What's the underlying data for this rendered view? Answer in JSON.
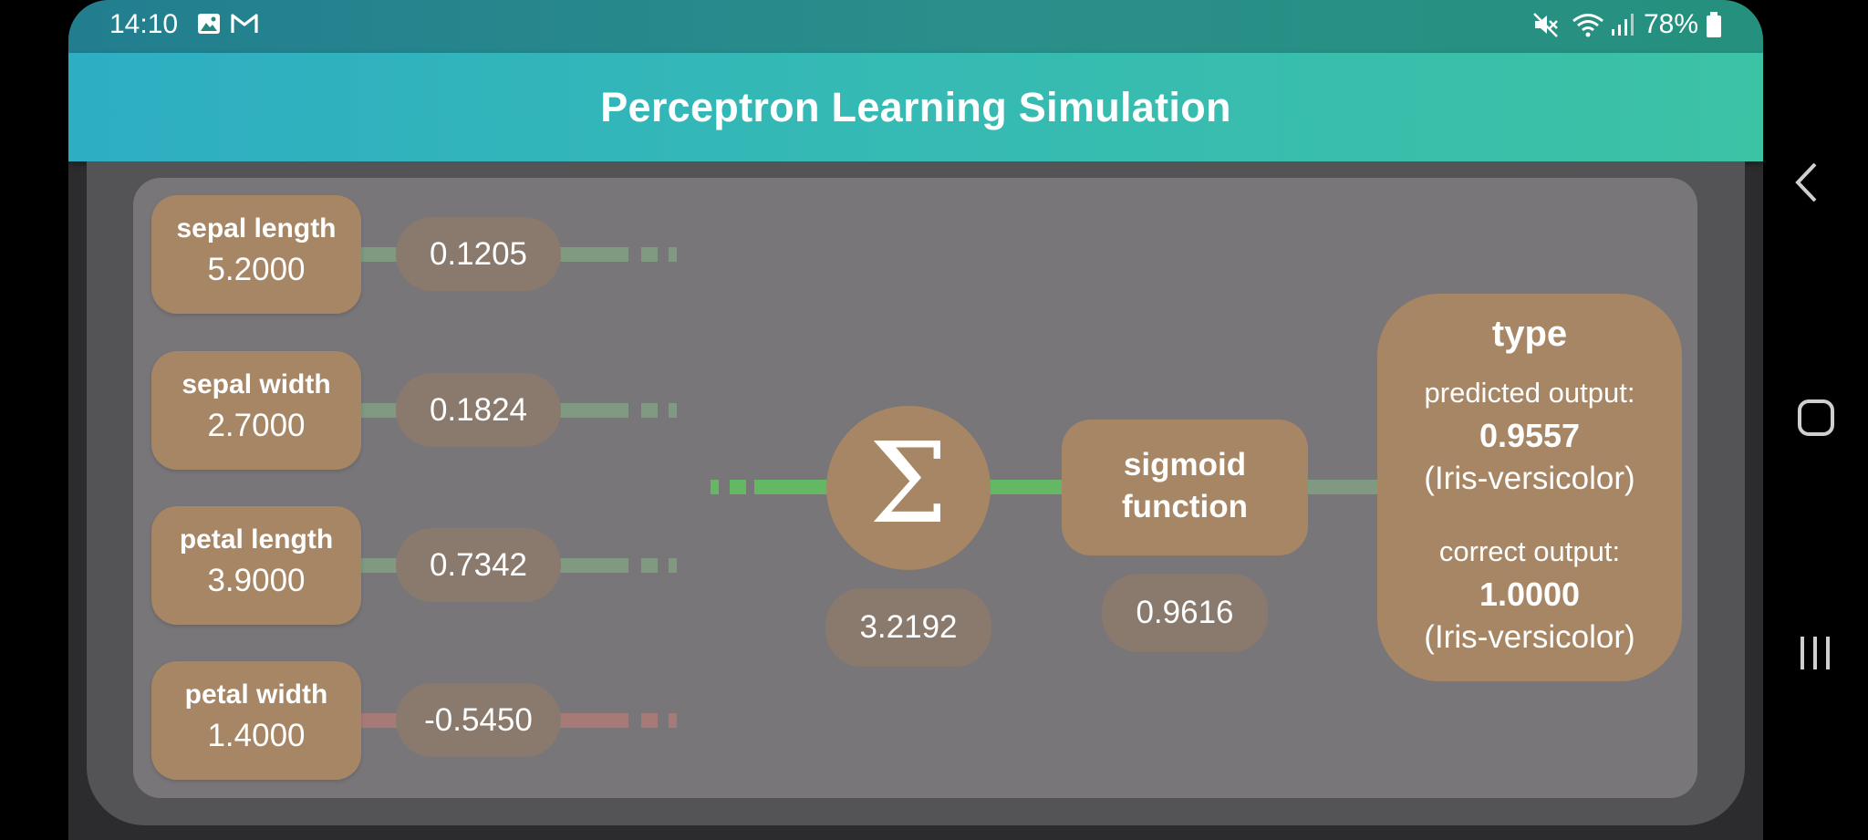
{
  "status_bar": {
    "time": "14:10",
    "battery": "78%",
    "icons": [
      "gallery-icon",
      "gmail-icon",
      "mute-icon",
      "wifi-icon",
      "signal-icon",
      "battery-icon"
    ]
  },
  "app_bar": {
    "title": "Perceptron Learning Simulation"
  },
  "inputs": [
    {
      "label": "sepal length",
      "value": "5.2000",
      "weight": "0.1205",
      "sign": "positive"
    },
    {
      "label": "sepal width",
      "value": "2.7000",
      "weight": "0.1824",
      "sign": "positive"
    },
    {
      "label": "petal length",
      "value": "3.9000",
      "weight": "0.7342",
      "sign": "positive"
    },
    {
      "label": "petal width",
      "value": "1.4000",
      "weight": "-0.5450",
      "sign": "negative"
    }
  ],
  "summation": {
    "symbol": "Σ",
    "value": "3.2192"
  },
  "activation": {
    "line1": "sigmoid",
    "line2": "function",
    "value": "0.9616"
  },
  "output": {
    "title": "type",
    "predicted_label": "predicted output:",
    "predicted_value": "0.9557",
    "predicted_class": "(Iris-versicolor)",
    "correct_label": "correct output:",
    "correct_value": "1.0000",
    "correct_class": "(Iris-versicolor)"
  },
  "colors": {
    "status_bar": "#26877f",
    "app_bar": "#35b9b5",
    "node": "#a68664",
    "value_pill": "#8a7a6e",
    "positive_line": "#7f9a80",
    "negative_line": "#a87a77",
    "active_line": "#64b864",
    "panel": "#787679"
  },
  "nav_bar": {
    "buttons": [
      "back-icon",
      "home-icon",
      "recents-icon"
    ]
  }
}
